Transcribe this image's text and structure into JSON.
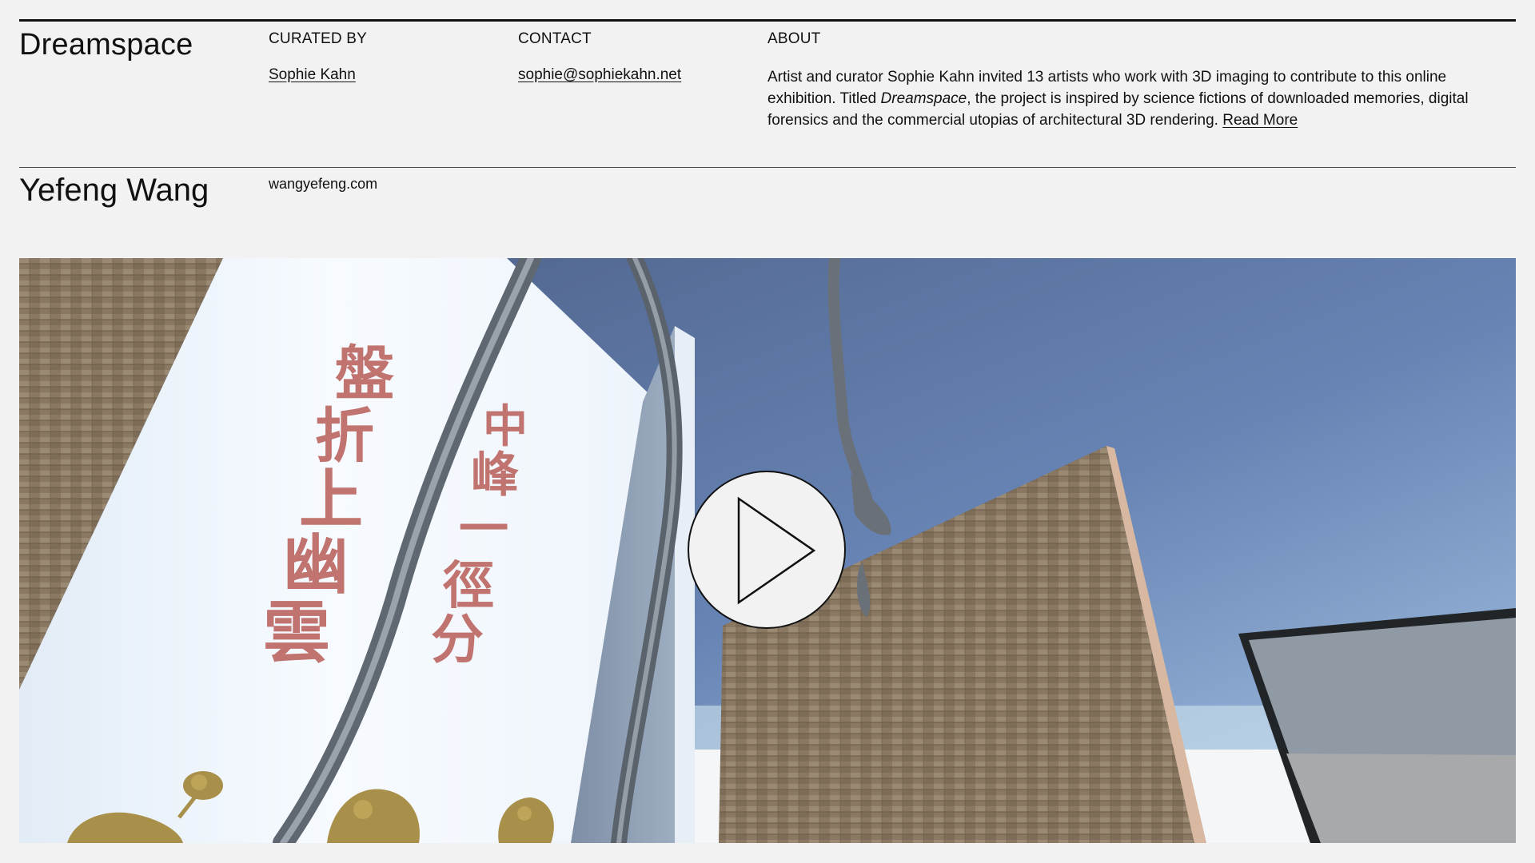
{
  "header": {
    "site_title": "Dreamspace",
    "curated_by_label": "CURATED BY",
    "curator_name": "Sophie Kahn",
    "contact_label": "CONTACT",
    "contact_email": "sophie@sophiekahn.net",
    "about_label": "ABOUT",
    "about_text_part1": "Artist and curator Sophie Kahn invited 13 artists who work with 3D imaging to contribute to this online exhibition. Titled ",
    "about_title_italic": "Dreamspace",
    "about_text_part2": ", the project is inspired by science fictions of downloaded memories, digital forensics and the commercial utopias of architectural 3D rendering. ",
    "read_more_label": "Read More"
  },
  "artist": {
    "name": "Yefeng Wang",
    "website": "wangyefeng.com"
  },
  "video": {
    "play_icon": "play-icon",
    "artwork_text": [
      "盤",
      "折",
      "上",
      "幽",
      "雲",
      "中",
      "峰",
      "一",
      "徑",
      "分"
    ]
  }
}
